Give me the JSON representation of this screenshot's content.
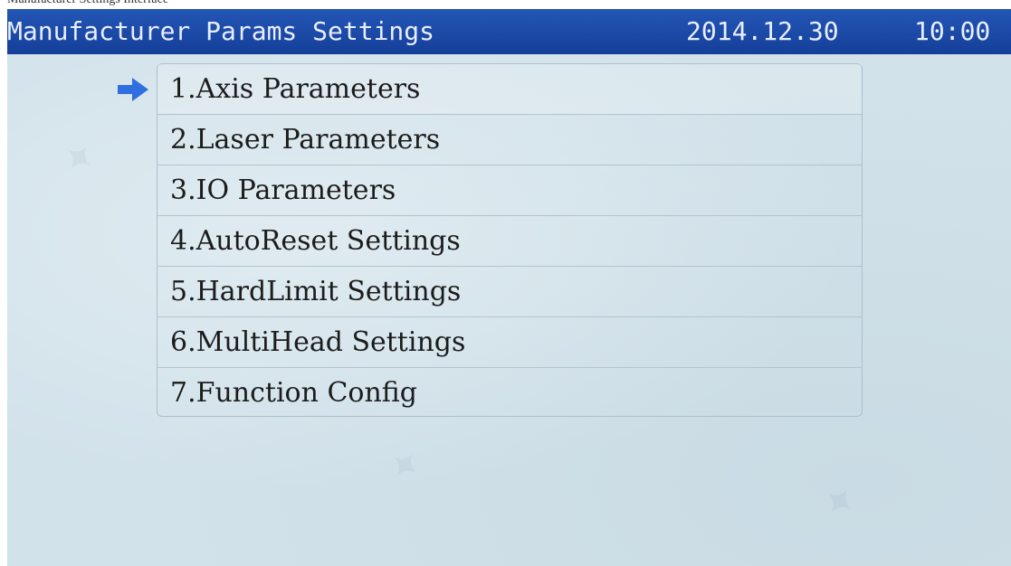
{
  "caption": "Manufacturer Settings Interface",
  "header": {
    "title": "Manufacturer Params Settings",
    "date": "2014.12.30",
    "time": "10:00"
  },
  "menu": {
    "selected_index": 0,
    "items": [
      {
        "label": "1.Axis Parameters"
      },
      {
        "label": "2.Laser Parameters"
      },
      {
        "label": "3.IO Parameters"
      },
      {
        "label": "4.AutoReset Settings"
      },
      {
        "label": "5.HardLimit Settings"
      },
      {
        "label": "6.MultiHead Settings"
      },
      {
        "label": "7.Function Config"
      }
    ]
  },
  "colors": {
    "titlebar": "#1a4aa8",
    "screen_bg": "#d2e2ea",
    "arrow": "#2f6fe0",
    "menu_text": "#1c1c1c"
  },
  "icons": {
    "selection_pointer": "right-arrow-icon"
  }
}
